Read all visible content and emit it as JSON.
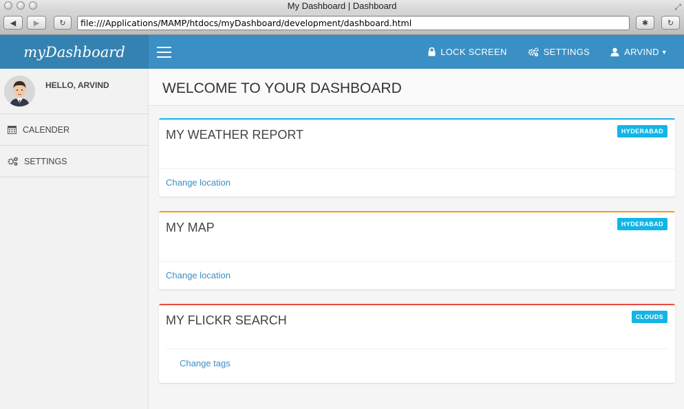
{
  "window": {
    "title": "My Dashboard | Dashboard"
  },
  "browser": {
    "url": "file:///Applications/MAMP/htdocs/myDashboard/development/dashboard.html"
  },
  "brand": "myDashboard",
  "topnav": {
    "lock": "LOCK SCREEN",
    "settings": "SETTINGS",
    "user": "ARVIND"
  },
  "sidebar": {
    "greeting": "HELLO, ARVIND",
    "items": [
      {
        "label": "CALENDER"
      },
      {
        "label": "SETTINGS"
      }
    ]
  },
  "page": {
    "title": "WELCOME TO YOUR DASHBOARD"
  },
  "panels": [
    {
      "title": "MY WEATHER REPORT",
      "badge": "HYDERABAD",
      "link": "Change location",
      "accent": "#12b5e6"
    },
    {
      "title": "MY MAP",
      "badge": "HYDERABAD",
      "link": "Change location",
      "accent": "#f39c12"
    },
    {
      "title": "MY FLICKR SEARCH",
      "badge": "CLOUDS",
      "link": "Change tags",
      "accent": "#e74c3c"
    }
  ]
}
